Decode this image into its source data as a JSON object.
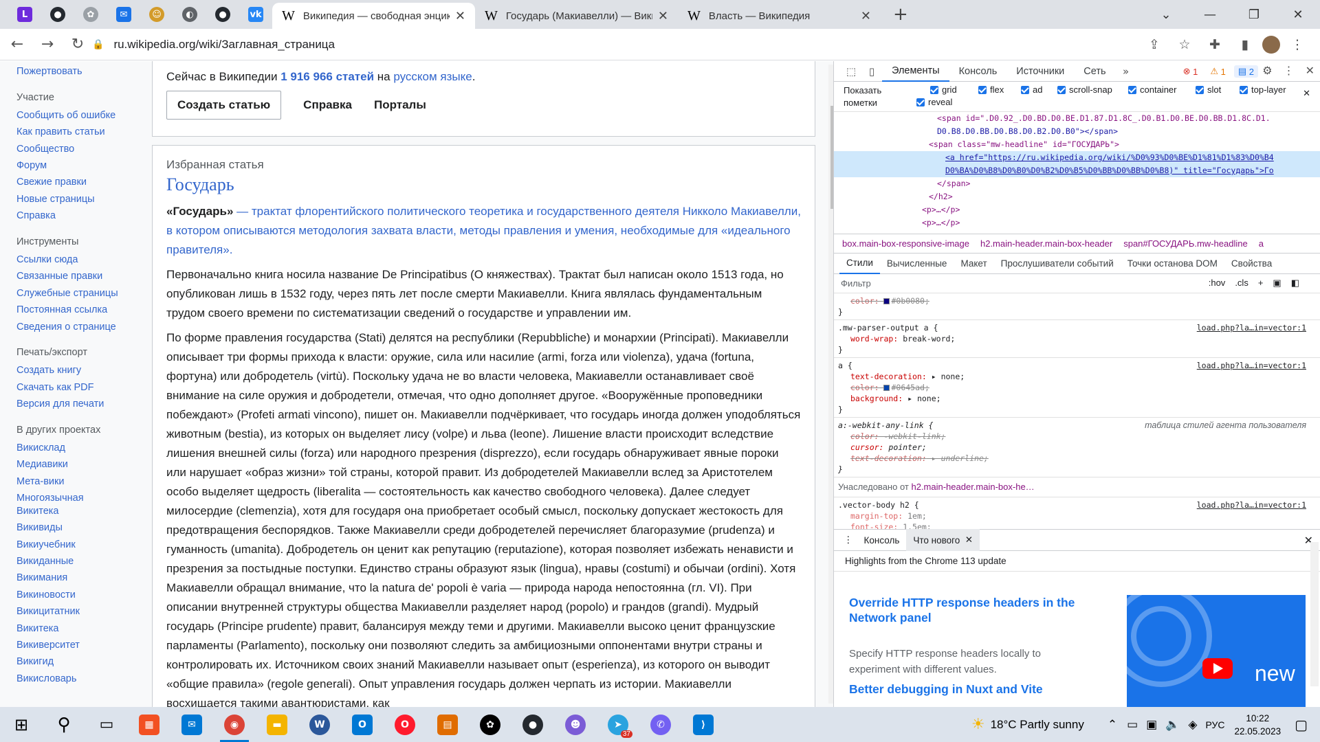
{
  "browser": {
    "pinned_tabs": [
      {
        "icon": "letter-l-icon",
        "label": "L",
        "color": "#6e2bdc"
      },
      {
        "icon": "github-icon",
        "label": "",
        "color": "#24292f"
      },
      {
        "icon": "gear-puzzle-icon",
        "label": "",
        "color": "#9aa0a6"
      },
      {
        "icon": "mail-icon",
        "label": "",
        "color": "#1a73e8"
      },
      {
        "icon": "smiley-icon",
        "label": "",
        "color": "#d39b2a"
      },
      {
        "icon": "globe-icon",
        "label": "",
        "color": "#5f6368"
      },
      {
        "icon": "github-icon",
        "label": "",
        "color": "#24292f"
      },
      {
        "icon": "vk-icon",
        "label": "",
        "color": "#2787f5"
      }
    ],
    "tabs": [
      {
        "title": "Википедия — свободная энцик",
        "active": true
      },
      {
        "title": "Государь (Макиавелли) — Вики",
        "active": false
      },
      {
        "title": "Власть — Википедия",
        "active": false
      }
    ],
    "url": "ru.wikipedia.org/wiki/Заглавная_страница"
  },
  "wiki": {
    "sidebar_top_link": "Пожертвовать",
    "sections": [
      {
        "heading": "Участие",
        "links": [
          "Сообщить об ошибке",
          "Как править статьи",
          "Сообщество",
          "Форум",
          "Свежие правки",
          "Новые страницы",
          "Справка"
        ]
      },
      {
        "heading": "Инструменты",
        "links": [
          "Ссылки сюда",
          "Связанные правки",
          "Служебные страницы",
          "Постоянная ссылка",
          "Сведения о странице"
        ]
      },
      {
        "heading": "Печать/экспорт",
        "links": [
          "Создать книгу",
          "Скачать как PDF",
          "Версия для печати"
        ]
      },
      {
        "heading": "В других проектах",
        "links": [
          "Викисклад",
          "Медиавики",
          "Мета-вики",
          "Многоязычная Викитека",
          "Викивиды",
          "Викиучебник",
          "Викиданные",
          "Викимания",
          "Викиновости",
          "Викицитатник",
          "Викитека",
          "Викиверситет",
          "Викигид",
          "Викисловарь"
        ]
      }
    ],
    "stats": {
      "prefix": "Сейчас в Википедии",
      "count": "1 916 966 статей",
      "mid": "на",
      "lang": "русском языке",
      "suffix": "."
    },
    "buttons": {
      "create": "Создать статью",
      "help": "Справка",
      "portals": "Порталы"
    },
    "featured": {
      "kicker": "Избранная статья",
      "title": "Государь",
      "lead_bold": "«Государь»",
      "lead_rest": " — трактат флорентийского политического теоретика и государственного деятеля Никколо Макиавелли, в котором описываются методология захвата власти, методы правления и умения, необходимые для «идеального правителя».",
      "p1": "Первоначально книга носила название De Principatibus (О княжествах). Трактат был написан около 1513 года, но опубликован лишь в 1532 году, через пять лет после смерти Макиавелли. Книга являлась фундаментальным трудом своего времени по систематизации сведений о государстве и управлении им.",
      "p2": "По форме правления государства (Stati) делятся на республики (Repubbliche) и монархии (Principati). Макиавелли описывает три формы прихода к власти: оружие, сила или насилие (armi, forza или violenza), удача (fortuna, фортуна) или добродетель (virtù). Поскольку удача не во власти человека, Макиавелли останавливает своё внимание на силе оружия и добродетели, отмечая, что одно дополняет другое. «Вооружённые проповедники побеждают» (Profeti armati vincono), пишет он. Макиавелли подчёркивает, что государь иногда должен уподобляться животным (bestia), из которых он выделяет лису (volpe) и льва (leone). Лишение власти происходит вследствие лишения внешней силы (forza) или народного презрения (disprezzo), если государь обнаруживает явные пороки или нарушает «образ жизни» той страны, которой правит. Из добродетелей Макиавелли вслед за Аристотелем особо выделяет щедрость (liberalita — состоятельность как качество свободного человека). Далее следует милосердие (clemenzia), хотя для государя она приобретает особый смысл, поскольку допускает жестокость для предотвращения беспорядков. Также Макиавелли среди добродетелей перечисляет благоразумие (prudenza) и гуманность (umanita). Добродетель он ценит как репутацию (reputazione), которая позволяет избежать ненависти и презрения за постыдные поступки. Единство страны образуют язык (lingua), нравы (costumi) и обычаи (ordini). Хотя Макиавелли обращал внимание, что la natura de' popoli è varia — природа народа непостоянна (гл. VI). При описании внутренней структуры общества Макиавелли разделяет народ (popolo) и грандов (grandi). Мудрый государь (Principe prudente) правит, балансируя между теми и другими. Макиавелли высоко ценит французские парламенты (Parlamento), поскольку они позволяют следить за амбициозными оппонентами внутри страны и контролировать их. Источником своих знаний Макиавелли называет опыт (esperienza), из которого он выводит «общие правила» (regole generali). Опыт управления государь должен черпать из истории. Макиавелли восхищается такими авантюристами, как"
    }
  },
  "devtools": {
    "tabs": [
      "Элементы",
      "Консоль",
      "Источники",
      "Сеть"
    ],
    "badges": {
      "errors": "1",
      "warnings": "1",
      "messages": "2"
    },
    "flags_label": "Показать пометки",
    "flags": [
      "grid",
      "flex",
      "ad",
      "scroll-snap",
      "container",
      "slot",
      "top-layer",
      "reveal"
    ],
    "dom_lines": [
      "<span id=\".D0.92_.D0.BD.D0.BE.D1.87.D1.8C_.D0.B1.D0.BE.D0.BB.D1.8C.D1.",
      "D0.B8.D0.BB.D0.B8.D0.B2.D0.B0\"></span>",
      "<span class=\"mw-headline\" id=\"ГОСУДАРЬ\">",
      "<a href=\"https://ru.wikipedia.org/wiki/%D0%93%D0%BE%D1%81%D1%83%D0%B4",
      "D0%BA%D0%B8%D0%B0%D0%B2%D0%B5%D0%BB%D0%BB%D0%B8)\" title=\"Государь\">Го",
      "</span>",
      "</h2>",
      "<p>…</p>",
      "<p>…</p>"
    ],
    "crumbs": [
      "box.main-box-responsive-image",
      "h2.main-header.main-box-header",
      "span#ГОСУДАРЬ.mw-headline",
      "a"
    ],
    "sub_tabs": [
      "Стили",
      "Вычисленные",
      "Макет",
      "Прослушиватели событий",
      "Точки останова DOM",
      "Свойства"
    ],
    "filter_placeholder": "Фильтр",
    "filter_hov": ":hov",
    "filter_cls": ".cls",
    "rules": {
      "r0_prop": "color:",
      "r0_val": "#0b0080;",
      "r1_sel": ".mw-parser-output a {",
      "r1_src": "load.php?la…in=vector:1",
      "r1_prop": "word-wrap:",
      "r1_val": "break-word;",
      "r2_sel": "a {",
      "r2_src": "load.php?la…in=vector:1",
      "r2_p1": "text-decoration:",
      "r2_v1": "none;",
      "r2_p2": "color:",
      "r2_v2": "#0645ad;",
      "r2_p3": "background:",
      "r2_v3": "none;",
      "r3_sel": "a:-webkit-any-link {",
      "r3_src": "таблица стилей агента пользователя",
      "r3_p1": "color:",
      "r3_v1": "-webkit-link;",
      "r3_p2": "cursor:",
      "r3_v2": "pointer;",
      "r3_p3": "text-decoration:",
      "r3_v3": "underline;",
      "inherited_prefix": "Унаследовано от",
      "inherited_from": "h2.main-header.main-box-he…",
      "r4_sel": ".vector-body h2 {",
      "r4_src": "load.php?la…in=vector:1",
      "r4_p1": "margin-top:",
      "r4_v1": "1em;",
      "r4_p2": "font-size:",
      "r4_v2": "1.5em;",
      "close": "}"
    },
    "drawer_tabs": [
      "Консоль",
      "Что нового"
    ],
    "whatsnew_header": "Highlights from the Chrome 113 update",
    "wn1_title": "Override HTTP response headers in the Network panel",
    "wn1_desc": "Specify HTTP response headers locally to experiment with different values.",
    "wn2_title": "Better debugging in Nuxt and Vite",
    "wn_image_text": "new"
  },
  "taskbar": {
    "weather": "18°C  Partly sunny",
    "lang": "РУС",
    "time": "10:22",
    "date": "22.05.2023",
    "telegram_badge": "37"
  },
  "colors": {
    "link": "#3366cc",
    "accent": "#1a73e8"
  }
}
